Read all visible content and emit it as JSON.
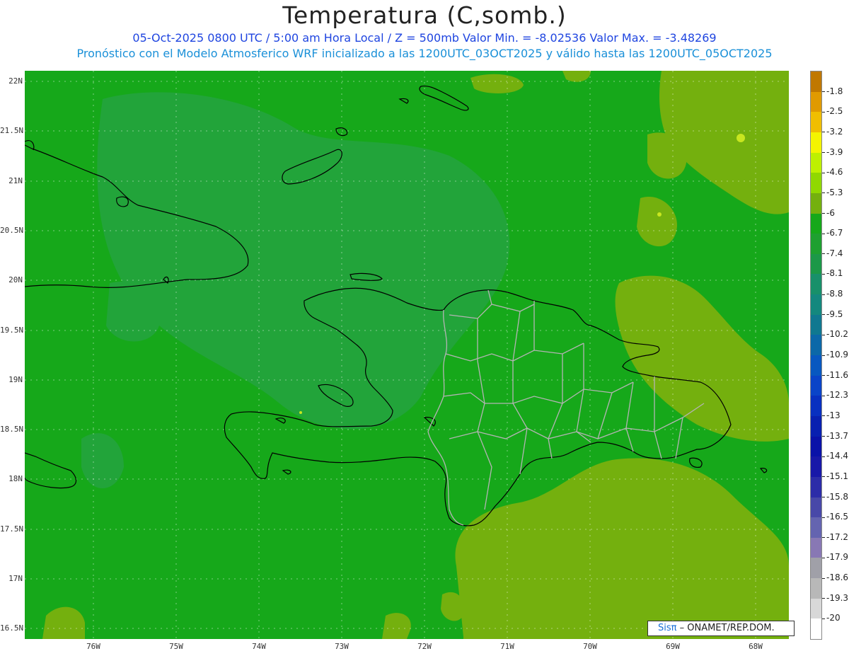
{
  "header": {
    "title": "Temperatura (C,somb.)",
    "line1": "05-Oct-2025   0800 UTC / 5:00 am Hora Local / Z = 500mb   Valor Min. = -8.02536   Valor Max. = -3.48269",
    "line2": "Pronóstico con el Modelo Atmosferico WRF inicializado a las 1200UTC_03OCT2025 y válido hasta las  1200UTC_05OCT2025"
  },
  "map": {
    "lat_labels": [
      "22N",
      "21.5N",
      "21N",
      "20.5N",
      "20N",
      "19.5N",
      "19N",
      "18.5N",
      "18N",
      "17.5N",
      "17N",
      "16.5N"
    ],
    "lon_labels": [
      "76W",
      "75W",
      "74W",
      "73W",
      "72W",
      "71W",
      "70W",
      "69W",
      "68W"
    ],
    "field_colors": {
      "base": "#16a81a",
      "cooler": "#20a43c",
      "warmer": "#74b00e",
      "warm_spot": "#c8e620"
    },
    "coastline_color": "#000000",
    "border_color": "#b4b4b4"
  },
  "colorbar": {
    "labels": [
      "-1.8",
      "-2.5",
      "-3.2",
      "-3.9",
      "-4.6",
      "-5.3",
      "-6",
      "-6.7",
      "-7.4",
      "-8.1",
      "-8.8",
      "-9.5",
      "-10.2",
      "-10.9",
      "-11.6",
      "-12.3",
      "-13",
      "-13.7",
      "-14.4",
      "-15.1",
      "-15.8",
      "-16.5",
      "-17.2",
      "-17.9",
      "-18.6",
      "-19.3",
      "-20"
    ],
    "colors": [
      "#c07800",
      "#e09a00",
      "#f0be00",
      "#f4f400",
      "#bef000",
      "#90d800",
      "#74b00e",
      "#16a81a",
      "#1ea030",
      "#1c9848",
      "#18906a",
      "#14887e",
      "#107890",
      "#0c68a8",
      "#0858c0",
      "#0a44c8",
      "#0830c0",
      "#0820b0",
      "#0a12a8",
      "#1818a8",
      "#2c2ca8",
      "#4848a8",
      "#6464b0",
      "#8878b4",
      "#a0a0a8",
      "#b8b8b8",
      "#d8d8d8",
      "#ffffff"
    ]
  },
  "credit": {
    "logo": "Sisπ",
    "text": " – ONAMET/REP.DOM."
  }
}
